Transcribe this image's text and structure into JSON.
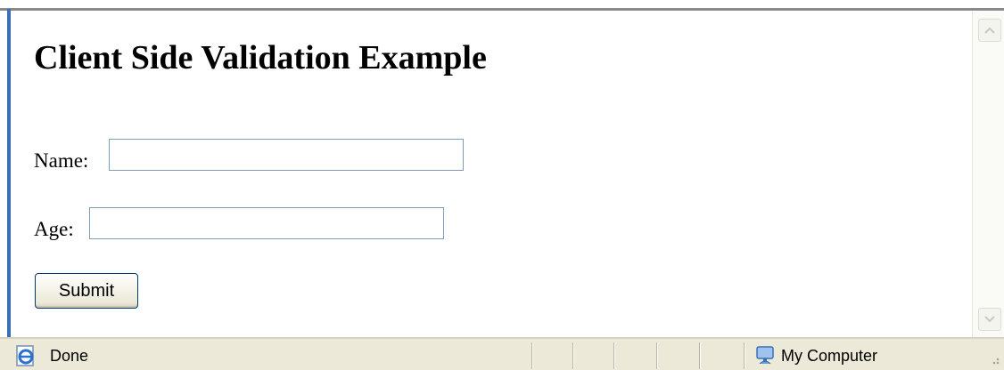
{
  "page": {
    "title": "Client Side Validation Example"
  },
  "form": {
    "name_label": "Name:",
    "name_value": "",
    "age_label": "Age:",
    "age_value": "",
    "submit_label": "Submit"
  },
  "status_bar": {
    "status_text": "Done",
    "zone_text": "My Computer",
    "status_icon": "ie-page-icon",
    "zone_icon": "my-computer-icon"
  },
  "colors": {
    "window_border": "#3a6fb5",
    "status_bar_bg": "#ece9d8",
    "input_border": "#7f9db9"
  }
}
